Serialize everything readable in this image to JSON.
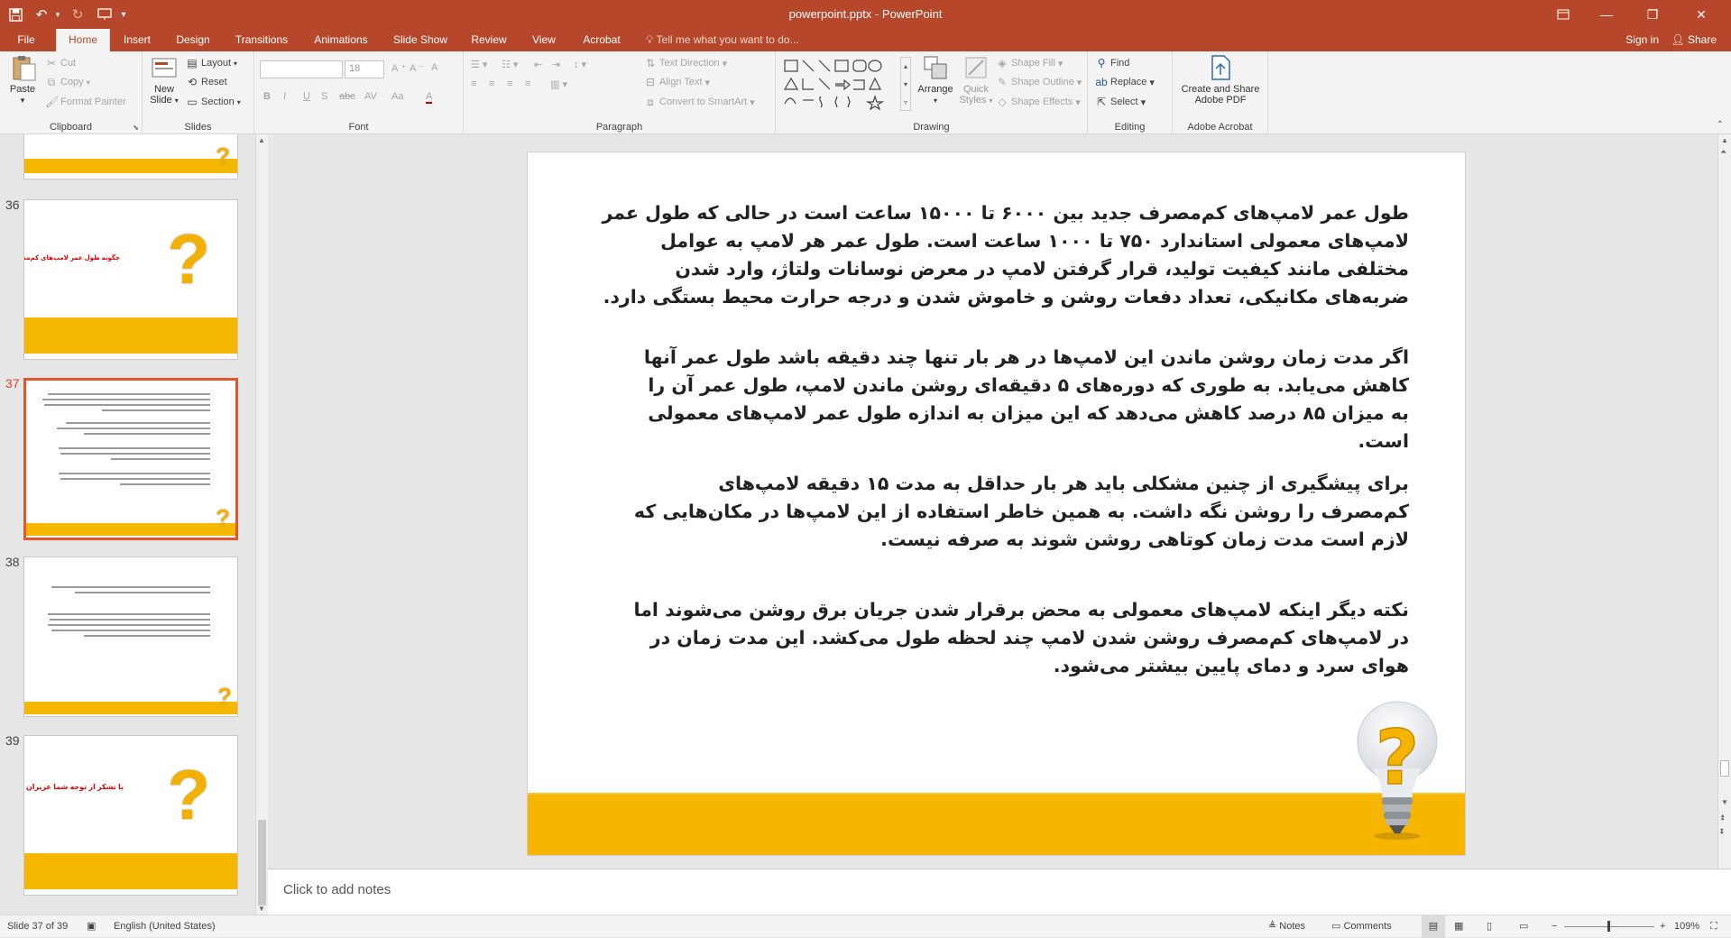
{
  "titlebar": {
    "document_title": "powerpoint.pptx - PowerPoint",
    "save_icon": "save-icon",
    "undo_icon": "undo-icon",
    "redo_icon": "redo-icon",
    "present_icon": "present-icon",
    "qat_more_icon": "chevron-down-icon",
    "ribbon_display_icon": "ribbon-display-icon",
    "minimize": "—",
    "restore": "❐",
    "close": "✕"
  },
  "tabs": {
    "items": [
      {
        "label": "File"
      },
      {
        "label": "Home"
      },
      {
        "label": "Insert"
      },
      {
        "label": "Design"
      },
      {
        "label": "Transitions"
      },
      {
        "label": "Animations"
      },
      {
        "label": "Slide Show"
      },
      {
        "label": "Review"
      },
      {
        "label": "View"
      },
      {
        "label": "Acrobat"
      }
    ],
    "active": "Home",
    "tell_me": "Tell me what you want to do...",
    "sign_in": "Sign in",
    "share": "Share"
  },
  "ribbon": {
    "clipboard": {
      "label": "Clipboard",
      "paste": "Paste",
      "cut": "Cut",
      "copy": "Copy",
      "format_painter": "Format Painter"
    },
    "slides": {
      "label": "Slides",
      "new_slide_line1": "New",
      "new_slide_line2": "Slide",
      "layout": "Layout",
      "reset": "Reset",
      "section": "Section"
    },
    "font": {
      "label": "Font",
      "font_name": "",
      "font_size": "18",
      "bold": "B",
      "italic": "I",
      "underline": "U",
      "shadow": "S",
      "strike": "abc",
      "spacing": "AV",
      "case": "Aa",
      "grow": "A",
      "shrink": "A",
      "clear": "A",
      "color": "A"
    },
    "paragraph": {
      "label": "Paragraph",
      "text_direction": "Text Direction",
      "align_text": "Align Text",
      "convert_smartart": "Convert to SmartArt"
    },
    "drawing": {
      "label": "Drawing",
      "arrange": "Arrange",
      "quick_styles_line1": "Quick",
      "quick_styles_line2": "Styles",
      "shape_fill": "Shape Fill",
      "shape_outline": "Shape Outline",
      "shape_effects": "Shape Effects"
    },
    "editing": {
      "label": "Editing",
      "find": "Find",
      "replace": "Replace",
      "select": "Select"
    },
    "acrobat": {
      "label": "Adobe Acrobat",
      "create_line1": "Create and Share",
      "create_line2": "Adobe PDF"
    }
  },
  "thumbnails": [
    {
      "number": "",
      "title": "",
      "selected": false
    },
    {
      "number": "36",
      "title": "چگونه طول عمر لامپ‌های کم‌مصرف را افزایش دهیم؟",
      "selected": false
    },
    {
      "number": "37",
      "title": "",
      "selected": true
    },
    {
      "number": "38",
      "title": "",
      "selected": false
    },
    {
      "number": "39",
      "title": "با تشکر از توجه شما عزیزان",
      "selected": false
    }
  ],
  "slide": {
    "paragraphs": [
      "طول عمر لامپ‌های کم‌مصرف جدید بین ۶۰۰۰ تا ۱۵۰۰۰ ساعت است در حالی که طول عمر لامپ‌های معمولی استاندارد ۷۵۰ تا ۱۰۰۰ ساعت است. طول عمر هر لامپ به عوامل مختلفی مانند کیفیت تولید، قرار گرفتن لامپ در معرض نوسانات ولتاژ، وارد شدن ضربه‌های مکانیکی، تعداد دفعات روشن و خاموش شدن و درجه حرارت محیط بستگی دارد.",
      "اگر مدت زمان روشن ماندن این لامپ‌ها در هر بار تنها چند دقیقه باشد طول عمر آنها کاهش می‌یابد. به طوری که دوره‌های ۵ دقیقه‌ای روشن ماندن لامپ، طول عمر آن را به میزان ۸۵ درصد کاهش می‌دهد که این میزان به اندازه طول عمر لامپ‌های معمولی است.",
      "برای پیشگیری از چنین مشکلی باید هر بار حداقل به مدت ۱۵ دقیقه لامپ‌های کم‌مصرف را روشن نگه داشت. به همین خاطر استفاده از این لامپ‌ها در مکان‌هایی که لازم است مدت زمان کوتاهی روشن شوند به صرفه نیست.",
      "نکته دیگر اینکه لامپ‌های معمولی به محض برقرار شدن جریان برق روشن می‌شوند اما در لامپ‌های کم‌مصرف روشن شدن لامپ چند لحظه طول می‌کشد. این مدت زمان در هوای سرد و دمای پایین بیشتر می‌شود."
    ],
    "bulb_icon": "lightbulb-question-icon",
    "band_color": "#f7b500"
  },
  "notes": {
    "placeholder": "Click to add notes"
  },
  "status": {
    "slide_info": "Slide 37 of 39",
    "language": "English (United States)",
    "notes": "Notes",
    "comments": "Comments",
    "zoom": "109%"
  },
  "colors": {
    "accent": "#b7472a",
    "selected_thumb": "#e5542f"
  }
}
